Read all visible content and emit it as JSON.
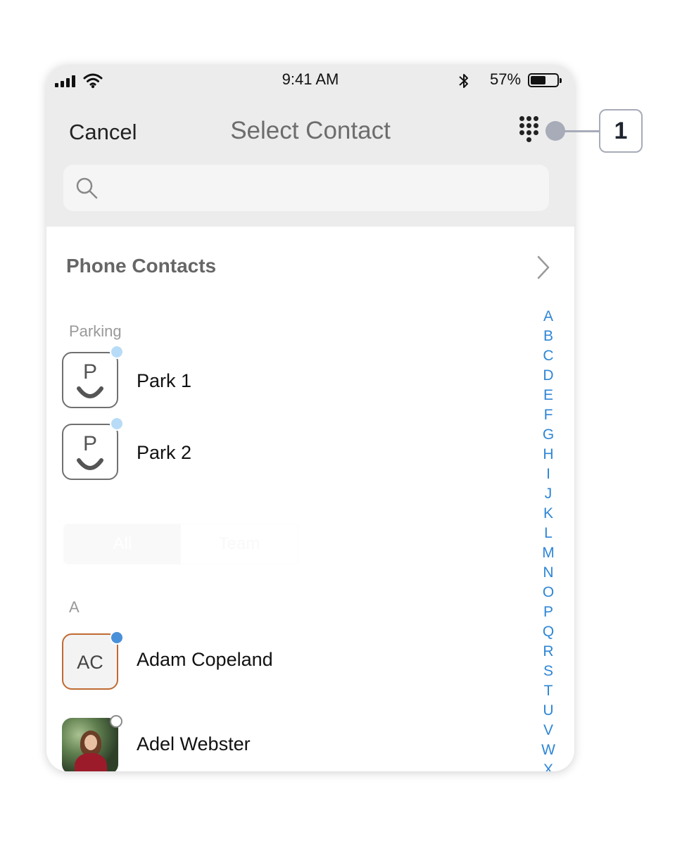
{
  "status_bar": {
    "time": "9:41 AM",
    "battery_percent": "57%",
    "battery_level": 0.57
  },
  "nav": {
    "cancel": "Cancel",
    "title": "Select Contact"
  },
  "search": {
    "placeholder": ""
  },
  "phone_contacts": {
    "label": "Phone Contacts"
  },
  "parking": {
    "header": "Parking",
    "items": [
      {
        "name": "Park 1",
        "letter": "P",
        "presence": "available",
        "presence_color": "#b8dcf7"
      },
      {
        "name": "Park 2",
        "letter": "P",
        "presence": "available",
        "presence_color": "#b8dcf7"
      }
    ]
  },
  "segments": {
    "all": "All",
    "team": "Team",
    "selected": "All"
  },
  "contacts": {
    "section": "A",
    "items": [
      {
        "name": "Adam Copeland",
        "initials": "AC",
        "presence": "online",
        "presence_color": "#4a90d9",
        "avatar_border": "#c06a32"
      },
      {
        "name": "Adel Webster",
        "presence": "offline",
        "presence_color": "#ffffff",
        "avatar": "photo"
      }
    ]
  },
  "alphabet_index": [
    "A",
    "B",
    "C",
    "D",
    "E",
    "F",
    "G",
    "H",
    "I",
    "J",
    "K",
    "L",
    "M",
    "N",
    "O",
    "P",
    "Q",
    "R",
    "S",
    "T",
    "U",
    "V",
    "W",
    "X"
  ],
  "callout": {
    "number": "1"
  },
  "colors": {
    "header_bg": "#ececec",
    "index_link": "#2e86d6",
    "callout": "#a8abb8"
  }
}
